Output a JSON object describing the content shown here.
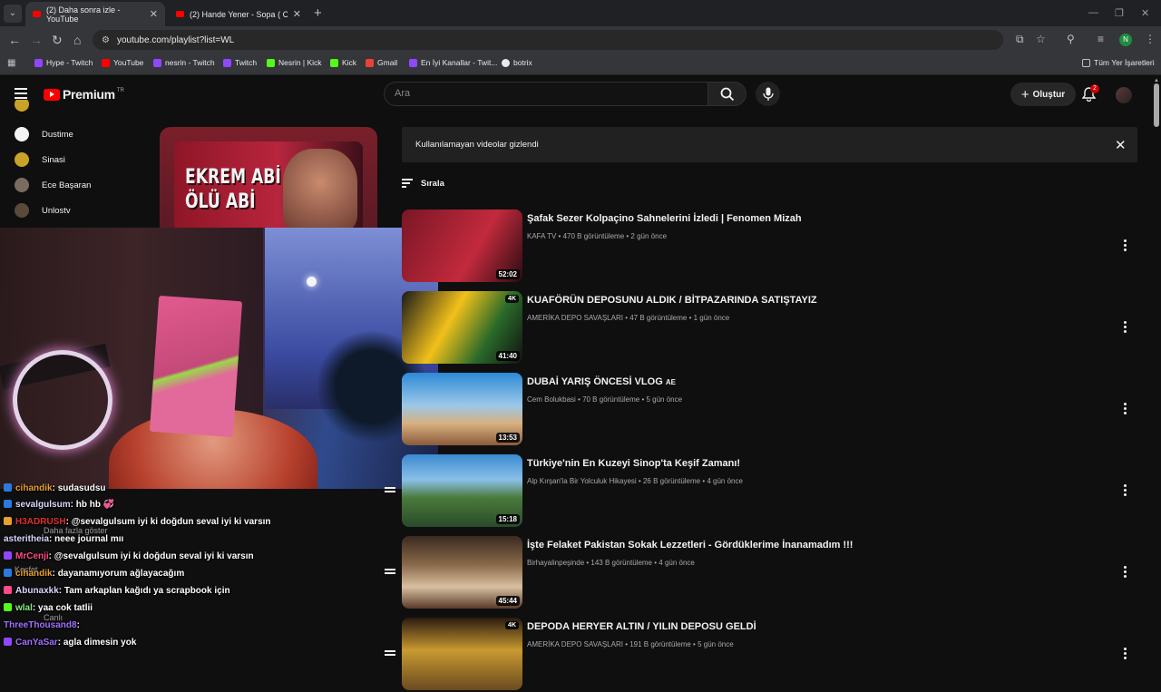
{
  "browser": {
    "tabs": [
      {
        "title": "(2) Daha sonra izle - YouTube",
        "active": true
      },
      {
        "title": "(2) Hande Yener - Sopa ( Club R",
        "active": false
      }
    ],
    "url": "youtube.com/playlist?list=WL",
    "profile_initial": "N",
    "bookmarks": [
      {
        "label": "Hype - Twitch",
        "color": "#9146ff"
      },
      {
        "label": "YouTube",
        "color": "#ff0000"
      },
      {
        "label": "nesrin - Twitch",
        "color": "#9146ff"
      },
      {
        "label": "Twitch",
        "color": "#9146ff"
      },
      {
        "label": "Nesrin | Kick",
        "color": "#53fc18"
      },
      {
        "label": "Kick",
        "color": "#53fc18"
      },
      {
        "label": "Gmail",
        "color": "#ea4335"
      },
      {
        "label": "En İyi Kanallar - Twit...",
        "color": "#9146ff"
      },
      {
        "label": "botrix",
        "color": "#e8eaed"
      }
    ],
    "all_bookmarks": "Tüm Yer İşaretleri"
  },
  "youtube": {
    "logo": "Premium",
    "logo_region": "TR",
    "search_placeholder": "Ara",
    "create_label": "Oluştur",
    "notification_count": "2",
    "sidebar": [
      {
        "label": "Dustime",
        "color": "#f4f4f4"
      },
      {
        "label": "Sinasi",
        "color": "#c9a227"
      },
      {
        "label": "Ece Başaran",
        "color": "#7a6a60"
      },
      {
        "label": "Unlostv",
        "color": "#5a4a3a"
      }
    ],
    "hero_title": [
      "EKREM ABİ",
      "ÖLÜ ABİ"
    ],
    "hidden_notice": "Kullanılamayan videolar gizlendi",
    "sort_label": "Sırala",
    "videos": [
      {
        "title": "Şafak Sezer Kolpaçino Sahnelerini İzledi | Fenomen Mizah",
        "channel": "KAFA TV",
        "views": "470 B görüntüleme",
        "age": "2 gün önce",
        "duration": "52:02",
        "is4k": false,
        "thumb": "linear-gradient(120deg,#7a1626,#c22a3c 60%,#2a0c12)"
      },
      {
        "title": "KUAFÖRÜN DEPOSUNU ALDIK / BİTPAZARINDA SATIŞTAYIZ",
        "channel": "AMERİKA DEPO SAVAŞLARI",
        "views": "47 B görüntüleme",
        "age": "1 gün önce",
        "duration": "41:40",
        "is4k": true,
        "thumb": "linear-gradient(120deg,#1a1a1a,#f2c01a 40%,#2a6a2a 70%,#111)"
      },
      {
        "title": "DUBAİ YARIŞ ÖNCESİ VLOG",
        "title_suffix": "AE",
        "channel": "Cem Bolukbasi",
        "views": "70 B görüntüleme",
        "age": "5 gün önce",
        "duration": "13:53",
        "is4k": false,
        "thumb": "linear-gradient(180deg,#2c8ad6,#9cc8e8 45%,#d8b080 70%,#8a5a3a)"
      },
      {
        "title": "Türkiye'nin En Kuzeyi Sinop'ta Keşif Zamanı!",
        "channel": "Alp Kırşan'la Bir Yolculuk Hikayesi",
        "views": "26 B görüntüleme",
        "age": "4 gün önce",
        "duration": "15:18",
        "is4k": false,
        "thumb": "linear-gradient(180deg,#3a8ad0,#8ac0e8 35%,#4a7a3a 60%,#2a4a2a)"
      },
      {
        "title": "İşte Felaket Pakistan Sokak Lezzetleri - Gördüklerime İnanamadım !!!",
        "channel": "Birhayalinpeşinde",
        "views": "143 B görüntüleme",
        "age": "4 gün önce",
        "duration": "45:44",
        "is4k": false,
        "thumb": "linear-gradient(180deg,#3a2a20,#8a6a4a 40%,#d8c0a0 70%,#5a3a2a)"
      },
      {
        "title": "DEPODA HERYER ALTIN / YILIN DEPOSU GELDİ",
        "channel": "AMERİKA DEPO SAVAŞLARI",
        "views": "191 B görüntüleme",
        "age": "5 gün önce",
        "duration": "",
        "is4k": true,
        "thumb": "linear-gradient(180deg,#2a1a10,#c89a30 45%,#6a4a20)"
      }
    ]
  },
  "chat": [
    {
      "user": "cihandik",
      "sep": ":",
      "msg": "sudasudsu",
      "color": "#e8a030",
      "icon": "#2a7ae0"
    },
    {
      "user": "sevalgulsum",
      "sep": ":",
      "msg": "hb hb 💞",
      "color": "#d8d8ff",
      "icon": "#2a7ae0"
    },
    {
      "user": "H3ADRUSH",
      "sep": ":",
      "msg": "@sevalgulsum iyi ki doğdun seval iyi ki varsın",
      "color": "#e03030",
      "icon": "#e8a030"
    },
    {
      "user": "asteritheia",
      "sep": ":",
      "msg": "neee journal mıı",
      "color": "#d8d8ff",
      "icon": ""
    },
    {
      "user": "MrCenji",
      "sep": ":",
      "msg": "@sevalgulsum iyi ki doğdun seval iyi ki varsın",
      "color": "#ff4a8a",
      "icon": "#9146ff"
    },
    {
      "user": "cihandik",
      "sep": ":",
      "msg": "dayanamıyorum ağlayacağım",
      "color": "#e8a030",
      "icon": "#2a7ae0"
    },
    {
      "user": "Abunaxkk",
      "sep": ":",
      "msg": "Tam arkaplan kağıdı ya scrapbook için",
      "color": "#d8d8ff",
      "icon": "#ff4a8a"
    },
    {
      "user": "wlal",
      "sep": ":",
      "msg": "yaa cok tatlii",
      "color": "#8ae88a",
      "icon": "#53fc18"
    },
    {
      "user": "ThreeThousand8",
      "sep": ":",
      "msg": "",
      "color": "#a070ff",
      "icon": ""
    },
    {
      "user": "CanYaSar",
      "sep": ":",
      "msg": "agla dimesin yok",
      "color": "#a070ff",
      "icon": "#9146ff"
    }
  ],
  "chat_ghost": {
    "more": "Daha fazla göster",
    "keşfet": "Keşfet",
    "live": "Canlı"
  }
}
